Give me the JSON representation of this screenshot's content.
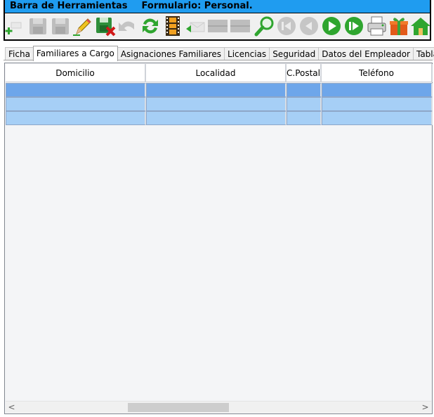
{
  "toolbar": {
    "title": "Barra de Herramientas",
    "form_label": "Formulario: Personal.",
    "buttons": [
      {
        "name": "add-record-icon",
        "enabled": true
      },
      {
        "name": "save-icon",
        "enabled": false
      },
      {
        "name": "save-as-icon",
        "enabled": false
      },
      {
        "name": "edit-pencil-icon",
        "enabled": true
      },
      {
        "name": "delete-record-icon",
        "enabled": true
      },
      {
        "name": "undo-icon",
        "enabled": false
      },
      {
        "name": "refresh-icon",
        "enabled": true
      },
      {
        "name": "film-strip-icon",
        "enabled": true
      },
      {
        "name": "mail-reply-icon",
        "enabled": false
      },
      {
        "name": "blank-button-1-icon",
        "enabled": false
      },
      {
        "name": "blank-button-2-icon",
        "enabled": false
      },
      {
        "name": "search-magnifier-icon",
        "enabled": true
      },
      {
        "name": "first-record-icon",
        "enabled": false
      },
      {
        "name": "previous-record-icon",
        "enabled": false
      },
      {
        "name": "next-record-icon",
        "enabled": true
      },
      {
        "name": "last-record-icon",
        "enabled": true
      },
      {
        "name": "print-icon",
        "enabled": true
      },
      {
        "name": "gift-icon",
        "enabled": true
      },
      {
        "name": "home-icon",
        "enabled": true
      }
    ],
    "colors": {
      "title_bar": "#1f9cf0",
      "enabled_green": "#2fa52f"
    }
  },
  "tabs": [
    {
      "label": "Ficha",
      "active": false
    },
    {
      "label": "Familiares a Cargo",
      "active": true
    },
    {
      "label": "Asignaciones Familiares",
      "active": false
    },
    {
      "label": "Licencias",
      "active": false
    },
    {
      "label": "Seguridad",
      "active": false
    },
    {
      "label": "Datos del Empleador",
      "active": false
    },
    {
      "label": "Tabla",
      "active": false
    }
  ],
  "grid": {
    "columns": [
      "Domicilio",
      "Localidad",
      "C.Postal",
      "Teléfono"
    ],
    "rows": [
      {
        "cells": [
          "",
          "",
          "",
          ""
        ],
        "selected": true
      },
      {
        "cells": [
          "",
          "",
          "",
          ""
        ],
        "selected": false
      },
      {
        "cells": [
          "",
          "",
          "",
          ""
        ],
        "selected": false
      }
    ],
    "colors": {
      "row": "#a6cff6",
      "selected_row": "#6ea6ea"
    }
  },
  "scrollbar": {
    "left_arrow": "<",
    "right_arrow": ">"
  }
}
